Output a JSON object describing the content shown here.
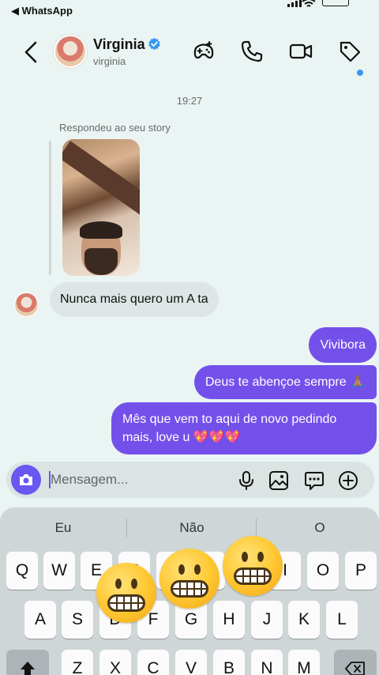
{
  "status_bar": {
    "back_app": "◀ WhatsApp"
  },
  "header": {
    "name": "Virginia",
    "username": "virginia",
    "icons": [
      "back-icon",
      "verified-icon",
      "game-icon",
      "phone-icon",
      "video-icon",
      "tag-icon"
    ]
  },
  "chat": {
    "timestamp": "19:27",
    "replied_label": "Respondeu ao seu story",
    "incoming": [
      {
        "text": "Nunca mais quero um A ta"
      }
    ],
    "outgoing": [
      {
        "text": "Vivibora"
      },
      {
        "text": "Deus te abençoe sempre 🙏🏽"
      },
      {
        "text": "Mês que vem to aqui de novo pedindo mais, love u 💖💖💖"
      }
    ]
  },
  "composer": {
    "placeholder": "Mensagem...",
    "icons": [
      "camera-icon",
      "mic-icon",
      "gallery-icon",
      "sticker-icon",
      "plus-icon"
    ]
  },
  "keyboard": {
    "suggestions": [
      "Eu",
      "Não",
      "O"
    ],
    "row1": [
      "Q",
      "W",
      "E",
      "R",
      "T",
      "Y",
      "U",
      "I",
      "O",
      "P"
    ],
    "row2": [
      "A",
      "S",
      "D",
      "F",
      "G",
      "H",
      "J",
      "K",
      "L"
    ],
    "row3": [
      "Z",
      "X",
      "C",
      "V",
      "B",
      "N",
      "M"
    ],
    "overlay": "grimacing-emoji"
  },
  "colors": {
    "accent": "#7450EA",
    "background": "#EAF4F3",
    "incoming_bubble": "#DDE6E5"
  }
}
